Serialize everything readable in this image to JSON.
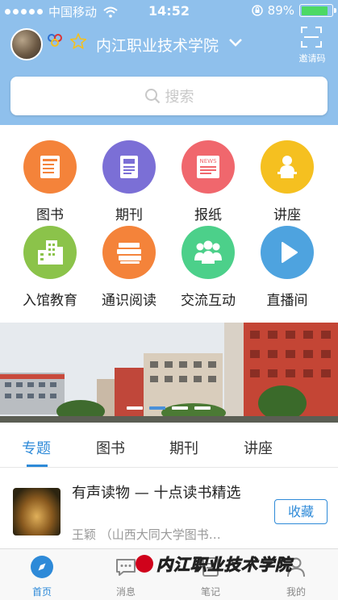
{
  "status_bar": {
    "carrier": "中国移动",
    "time": "14:52",
    "battery_percent": "89%",
    "battery_level": 0.89,
    "battery_color": "#4cd964"
  },
  "header": {
    "school_name": "内江职业技术学院",
    "invite_label": "邀请码",
    "accent": "#8fc0ec"
  },
  "search": {
    "placeholder": "搜索"
  },
  "grid": [
    {
      "label": "图书",
      "icon": "book-icon",
      "color": "#f4833a"
    },
    {
      "label": "期刊",
      "icon": "journal-icon",
      "color": "#7b6fd6"
    },
    {
      "label": "报纸",
      "icon": "newspaper-icon",
      "color": "#f0676d",
      "icon_text": "NEWS"
    },
    {
      "label": "讲座",
      "icon": "lecture-icon",
      "color": "#f5c020"
    },
    {
      "label": "入馆教育",
      "icon": "building-icon",
      "color": "#8bc34a"
    },
    {
      "label": "通识阅读",
      "icon": "books-stack-icon",
      "color": "#f4833a"
    },
    {
      "label": "交流互动",
      "icon": "people-icon",
      "color": "#4cd08a"
    },
    {
      "label": "直播间",
      "icon": "play-icon",
      "color": "#4ea3df"
    }
  ],
  "banner": {
    "pages": 4,
    "active_page": 2
  },
  "tabs": [
    {
      "label": "专题",
      "active": true
    },
    {
      "label": "图书",
      "active": false
    },
    {
      "label": "期刊",
      "active": false
    },
    {
      "label": "讲座",
      "active": false
    }
  ],
  "item": {
    "title": "有声读物 — 十点读书精选",
    "author": "王颖 （山西大同大学图书…",
    "favorite_label": "收藏"
  },
  "bottom_nav": [
    {
      "label": "首页",
      "icon": "compass-icon",
      "active": true
    },
    {
      "label": "消息",
      "icon": "message-icon",
      "active": false
    },
    {
      "label": "笔记",
      "icon": "note-icon",
      "active": false
    },
    {
      "label": "我的",
      "icon": "profile-icon",
      "active": false
    }
  ],
  "watermark": {
    "text": "内江职业技术学院"
  }
}
